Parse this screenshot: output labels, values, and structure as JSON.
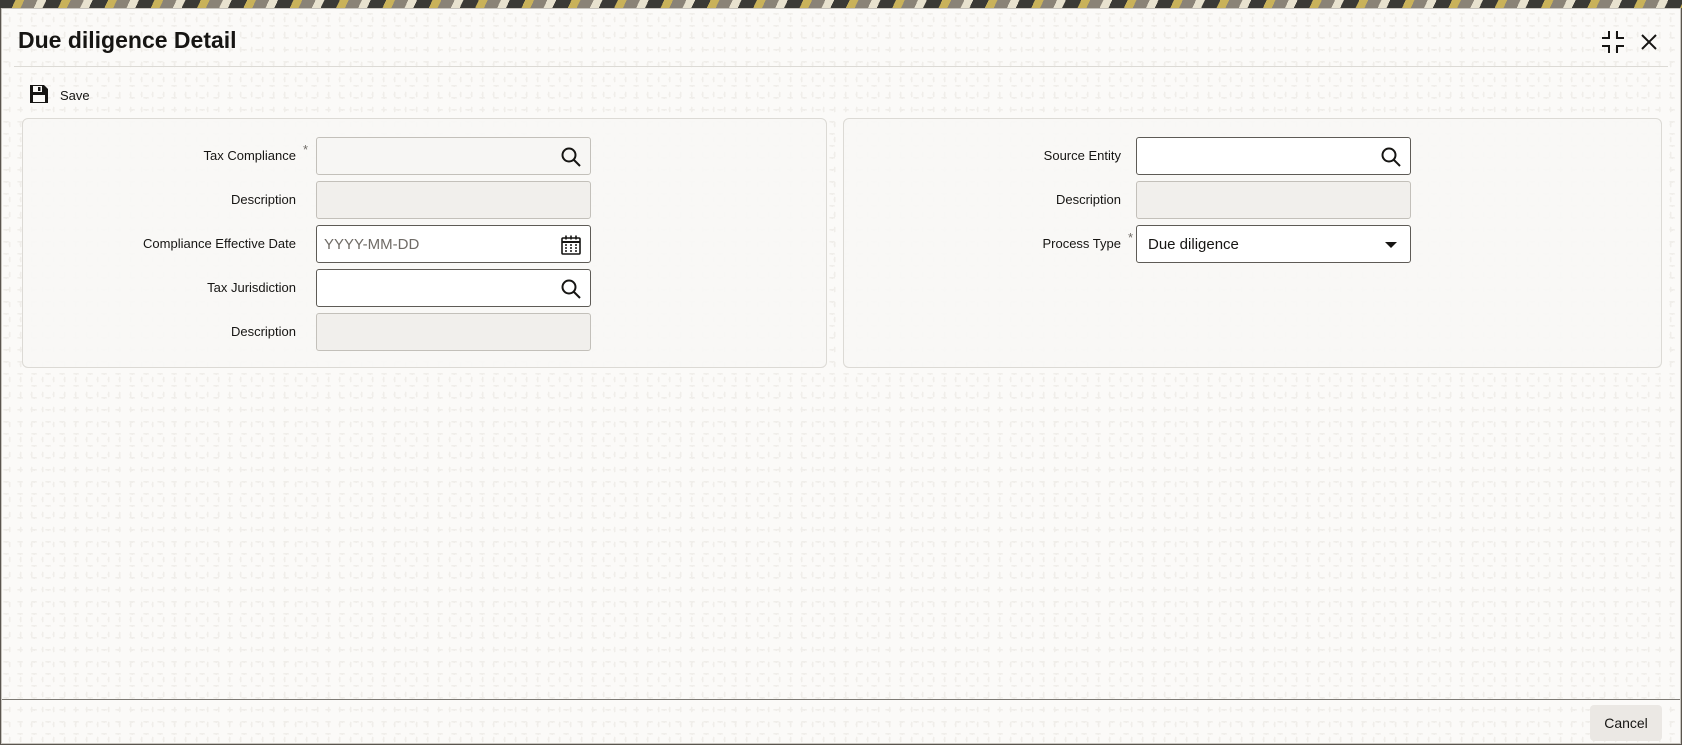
{
  "window": {
    "title": "Due diligence Detail",
    "controls": [
      "shrink-icon",
      "close-icon"
    ]
  },
  "toolbar": {
    "save_label": "Save",
    "save_icon": "floppy-disk-icon"
  },
  "left_panel": {
    "tax_compliance": {
      "label": "Tax Compliance",
      "required": "*",
      "value": "",
      "icon": "search-icon"
    },
    "description_1": {
      "label": "Description",
      "value": ""
    },
    "compliance_effective_date": {
      "label": "Compliance Effective Date",
      "placeholder": "YYYY-MM-DD",
      "icon": "calendar-icon"
    },
    "tax_jurisdiction": {
      "label": "Tax Jurisdiction",
      "value": "",
      "icon": "search-icon"
    },
    "description_2": {
      "label": "Description",
      "value": ""
    }
  },
  "right_panel": {
    "source_entity": {
      "label": "Source Entity",
      "value": "",
      "icon": "search-icon"
    },
    "description": {
      "label": "Description",
      "value": ""
    },
    "process_type": {
      "label": "Process Type",
      "required": "*",
      "selected": "Due diligence",
      "icon": "caret-down-icon"
    }
  },
  "footer": {
    "cancel_label": "Cancel"
  },
  "colors": {
    "text": "#161513",
    "panel_bg": "#f8f7f5",
    "border": "#c3c0ba",
    "active_border": "#5e5b56"
  }
}
